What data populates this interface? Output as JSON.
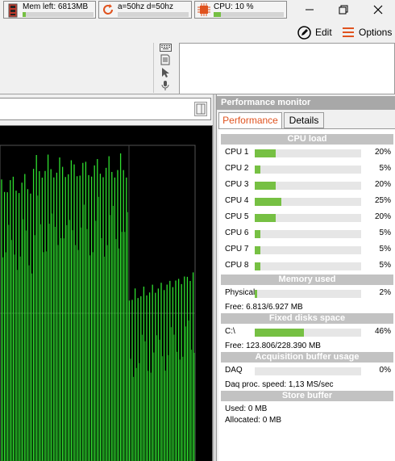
{
  "status": {
    "memory": {
      "label": "Mem left: 6813MB",
      "level_pct": 5
    },
    "trigger": {
      "label": "a=50hz d=50hz",
      "level_pct": 0
    },
    "cpu": {
      "label": "CPU: 10 %",
      "level_pct": 10
    },
    "accent": "#76c043"
  },
  "window_controls": {
    "minimize": "minimize-icon",
    "restore": "restore-icon",
    "close": "close-icon"
  },
  "toolbar": {
    "edit_label": "Edit",
    "options_label": "Options",
    "options_color": "#e0531f"
  },
  "side_icons": [
    "keyboard-icon",
    "document-icon",
    "pointer-icon",
    "microphone-icon"
  ],
  "performance_monitor": {
    "title": "Performance monitor",
    "tabs": [
      {
        "label": "Performance",
        "active": true
      },
      {
        "label": "Details",
        "active": false
      }
    ],
    "cpu_section": "CPU load",
    "cpus": [
      {
        "label": "CPU 1",
        "value": "20%",
        "pct": 20
      },
      {
        "label": "CPU 2",
        "value": "5%",
        "pct": 5
      },
      {
        "label": "CPU 3",
        "value": "20%",
        "pct": 20
      },
      {
        "label": "CPU 4",
        "value": "25%",
        "pct": 25
      },
      {
        "label": "CPU 5",
        "value": "20%",
        "pct": 20
      },
      {
        "label": "CPU 6",
        "value": "5%",
        "pct": 5
      },
      {
        "label": "CPU 7",
        "value": "5%",
        "pct": 5
      },
      {
        "label": "CPU 8",
        "value": "5%",
        "pct": 5
      }
    ],
    "memory_section": "Memory used",
    "memory": {
      "label": "Physical",
      "value": "2%",
      "pct": 2,
      "free": "Free: 6.813/6.927 MB"
    },
    "disk_section": "Fixed disks space",
    "disk": {
      "label": "C:\\",
      "value": "46%",
      "pct": 46,
      "free": "Free: 123.806/228.390 MB"
    },
    "acq_section": "Acquisition buffer usage",
    "acq": {
      "label": "DAQ",
      "value": "0%",
      "pct": 0,
      "speed": "Daq proc. speed: 1,13 MS/sec"
    },
    "store_section": "Store buffer",
    "store": {
      "used": "Used: 0 MB",
      "allocated": "Allocated: 0 MB"
    }
  }
}
